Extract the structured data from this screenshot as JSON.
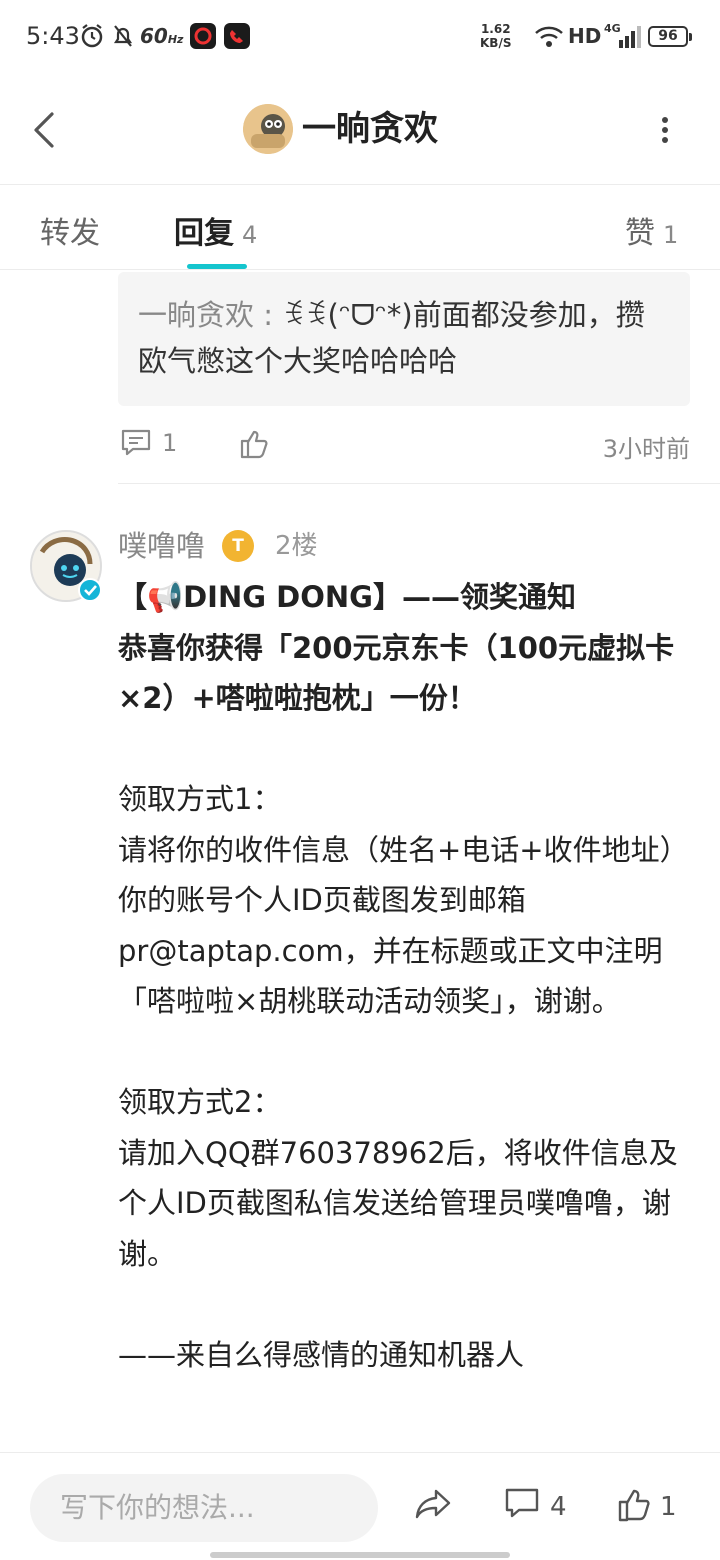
{
  "status_bar": {
    "time": "5:43",
    "refresh": "60",
    "refresh_unit": "Hz",
    "net_speed": "1.62",
    "net_unit": "KB/S",
    "hd": "HD",
    "network": "4G",
    "battery": "96"
  },
  "header": {
    "title": "一晌贪欢"
  },
  "tabs": [
    {
      "label": "转发",
      "count": ""
    },
    {
      "label": "回复",
      "count": "4"
    },
    {
      "label": "赞",
      "count": "1"
    }
  ],
  "quoted": {
    "author": "一晌贪欢",
    "separator": " : ",
    "text": "ꉂꉂ(ᵔᗜᵔ*)前面都没参加，攒欧气憋这个大奖哈哈哈哈"
  },
  "quoted_meta": {
    "comments": "1",
    "time": "3小时前"
  },
  "reply": {
    "username": "噗噜噜",
    "badge": "T",
    "floor": "2楼",
    "lines": [
      {
        "text": "【📢DING DONG】——领奖通知",
        "bold": true
      },
      {
        "text": "恭喜你获得「200元京东卡（100元虚拟卡×2）+嗒啦啦抱枕」一份！",
        "bold": true
      },
      {
        "text": "",
        "bold": false
      },
      {
        "text": "领取方式1：",
        "bold": false
      },
      {
        "text": "请将你的收件信息（姓名+电话+收件地址）你的账号个人ID页截图发到邮箱pr@taptap.com，并在标题或正文中注明「嗒啦啦×胡桃联动活动领奖」，谢谢。",
        "bold": false
      },
      {
        "text": "",
        "bold": false
      },
      {
        "text": "领取方式2：",
        "bold": false
      },
      {
        "text": "请加入QQ群760378962后，将收件信息及个人ID页截图私信发送给管理员噗噜噜，谢谢。",
        "bold": false
      },
      {
        "text": "",
        "bold": false
      },
      {
        "text": "——来自么得感情的通知机器人",
        "bold": false
      }
    ]
  },
  "bottom_bar": {
    "placeholder": "写下你的想法...",
    "comments": "4",
    "likes": "1"
  }
}
